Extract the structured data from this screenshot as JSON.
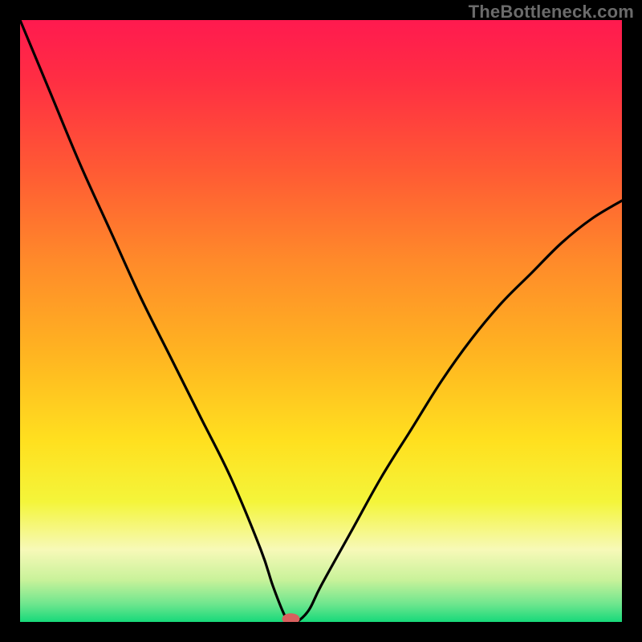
{
  "watermark": "TheBottleneck.com",
  "chart_data": {
    "type": "line",
    "title": "",
    "xlabel": "",
    "ylabel": "",
    "xlim": [
      0,
      100
    ],
    "ylim": [
      0,
      100
    ],
    "grid": false,
    "legend": false,
    "notes": "V-shaped bottleneck curve over a vertical rainbow gradient (red top → green bottom). Minimum near x≈45 where y≈0. A small red marker sits at the minimum. Axes and tick labels are not shown; values estimated from plot geometry.",
    "marker": {
      "x": 45,
      "y": 0.5
    },
    "series": [
      {
        "name": "bottleneck-curve",
        "x": [
          0,
          5,
          10,
          15,
          20,
          25,
          30,
          35,
          40,
          42,
          44,
          45,
          46,
          48,
          50,
          55,
          60,
          65,
          70,
          75,
          80,
          85,
          90,
          95,
          100
        ],
        "values": [
          100,
          88,
          76,
          65,
          54,
          44,
          34,
          24,
          12,
          6,
          1,
          0,
          0,
          2,
          6,
          15,
          24,
          32,
          40,
          47,
          53,
          58,
          63,
          67,
          70
        ]
      }
    ],
    "background_gradient": {
      "stops": [
        {
          "offset": 0.0,
          "color": "#ff1a4f"
        },
        {
          "offset": 0.1,
          "color": "#ff2e43"
        },
        {
          "offset": 0.25,
          "color": "#ff5a34"
        },
        {
          "offset": 0.4,
          "color": "#ff8a2a"
        },
        {
          "offset": 0.55,
          "color": "#ffb321"
        },
        {
          "offset": 0.7,
          "color": "#ffe01f"
        },
        {
          "offset": 0.8,
          "color": "#f4f53a"
        },
        {
          "offset": 0.88,
          "color": "#f7f9b8"
        },
        {
          "offset": 0.93,
          "color": "#c9f29a"
        },
        {
          "offset": 0.97,
          "color": "#6fe68e"
        },
        {
          "offset": 1.0,
          "color": "#17d97a"
        }
      ]
    }
  }
}
